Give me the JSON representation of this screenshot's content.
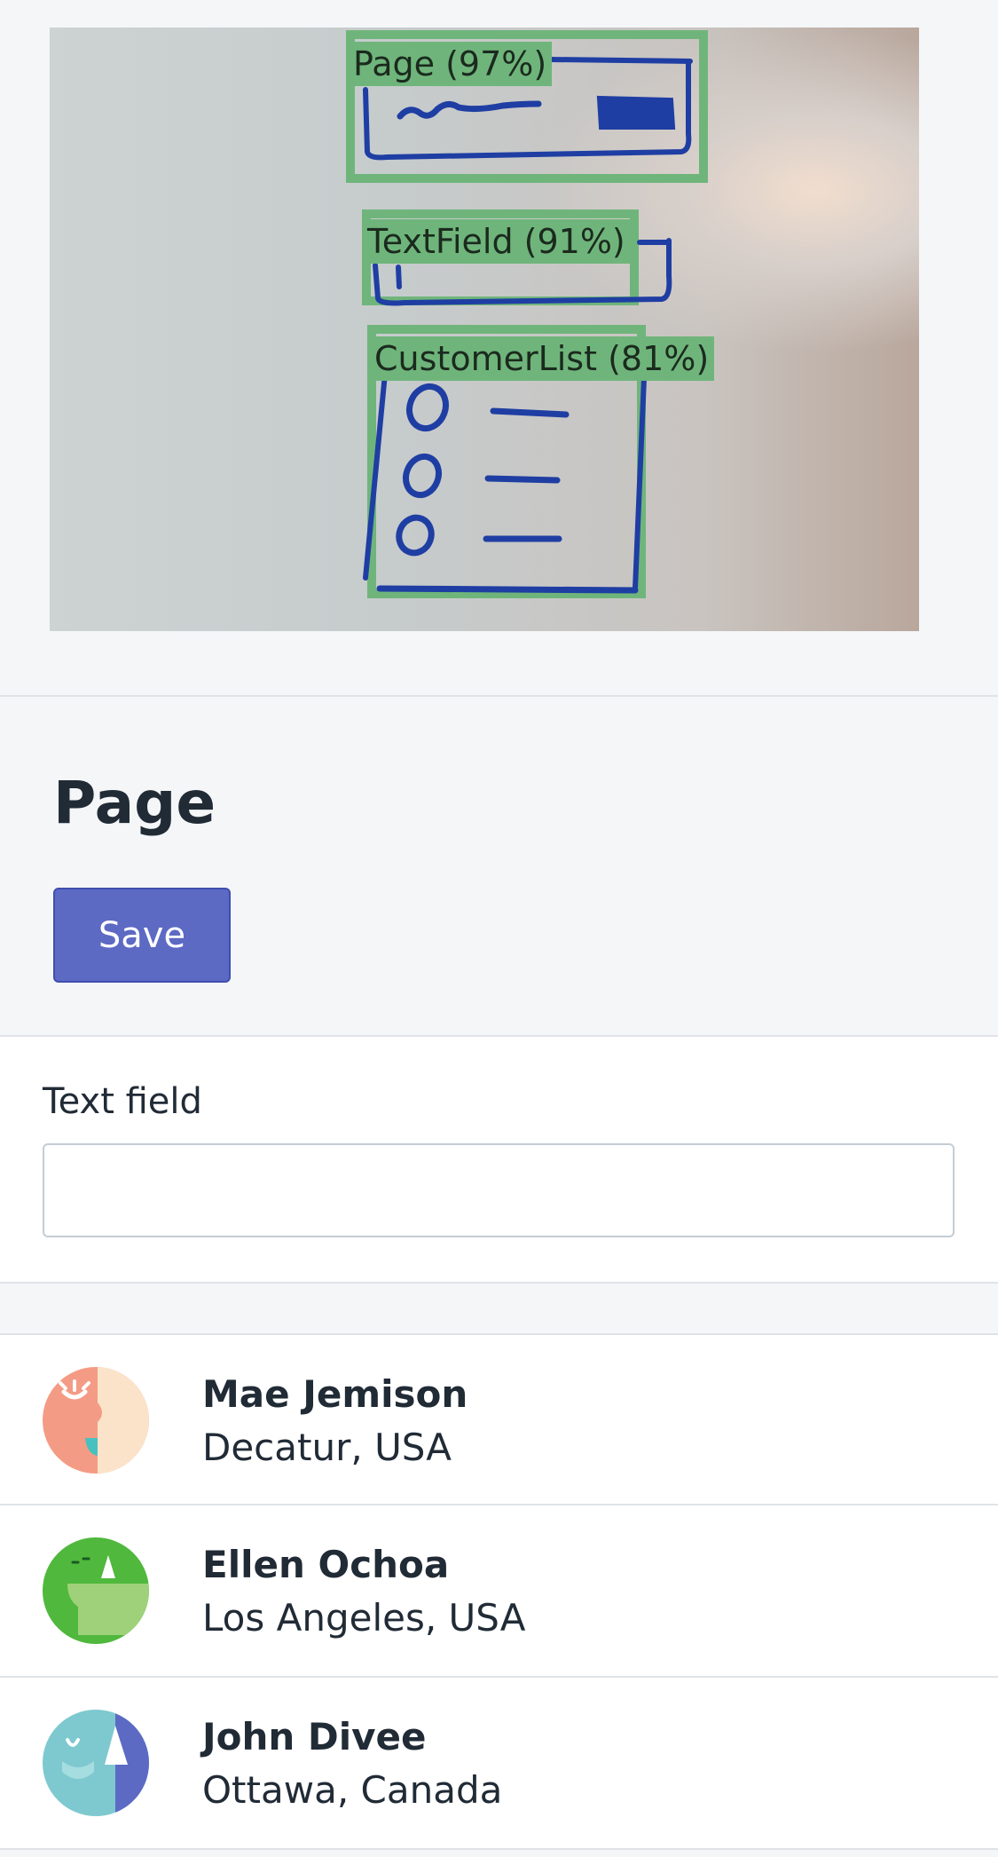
{
  "preview": {
    "detections": [
      {
        "label": "Page (97%)"
      },
      {
        "label": "TextField (91%)"
      },
      {
        "label": "CustomerList (81%)"
      }
    ]
  },
  "page": {
    "title": "Page",
    "save_label": "Save"
  },
  "form": {
    "field_label": "Text field",
    "field_value": "",
    "field_placeholder": ""
  },
  "customers": [
    {
      "name": "Mae Jemison",
      "location": "Decatur, USA",
      "avatar_icon": "avatar-sleeping-face-icon"
    },
    {
      "name": "Ellen Ochoa",
      "location": "Los Angeles, USA",
      "avatar_icon": "avatar-green-face-icon"
    },
    {
      "name": "John Divee",
      "location": "Ottawa, Canada",
      "avatar_icon": "avatar-teal-face-icon"
    }
  ],
  "colors": {
    "primary": "#5c6ac4",
    "detection_box": "#6fb57b",
    "marker_ink": "#1f3ea3",
    "background": "#f4f6f8"
  }
}
